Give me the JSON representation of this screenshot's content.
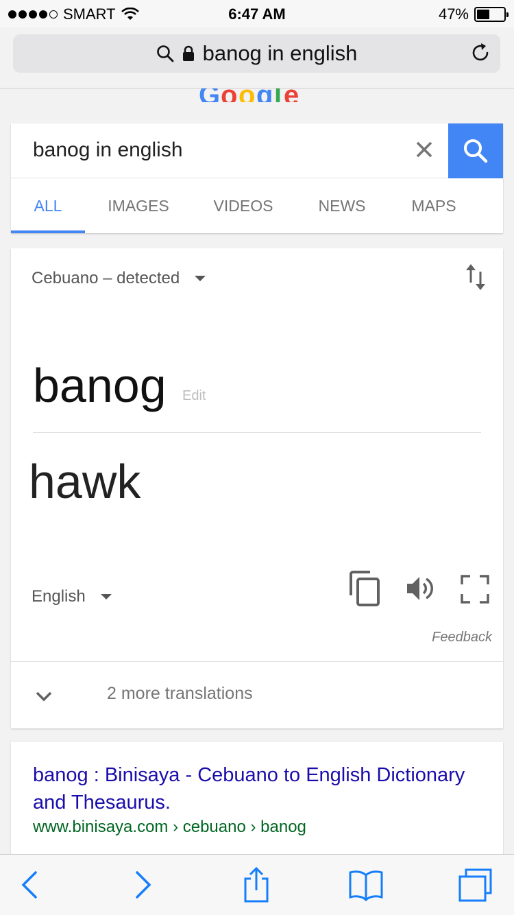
{
  "status_bar": {
    "carrier": "SMART",
    "time": "6:47 AM",
    "battery": "47%",
    "battery_level": 0.47
  },
  "address_bar": {
    "query": "banog in english"
  },
  "search": {
    "query": "banog in english",
    "tabs": [
      {
        "label": "ALL",
        "active": true
      },
      {
        "label": "IMAGES",
        "active": false
      },
      {
        "label": "VIDEOS",
        "active": false
      },
      {
        "label": "NEWS",
        "active": false
      },
      {
        "label": "MAPS",
        "active": false
      }
    ]
  },
  "translate": {
    "source_language": "Cebuano – detected",
    "source_text": "banog",
    "edit_label": "Edit",
    "translated_text": "hawk",
    "target_language": "English",
    "feedback_label": "Feedback",
    "more_translations": "2 more translations"
  },
  "result": {
    "title": "banog : Binisaya - Cebuano to English Dictionary and Thesaurus.",
    "url": "www.binisaya.com › cebuano › banog"
  },
  "colors": {
    "accent": "#4285f4",
    "link": "#1a0dab",
    "url": "#006621",
    "ios_blue": "#157efb"
  }
}
